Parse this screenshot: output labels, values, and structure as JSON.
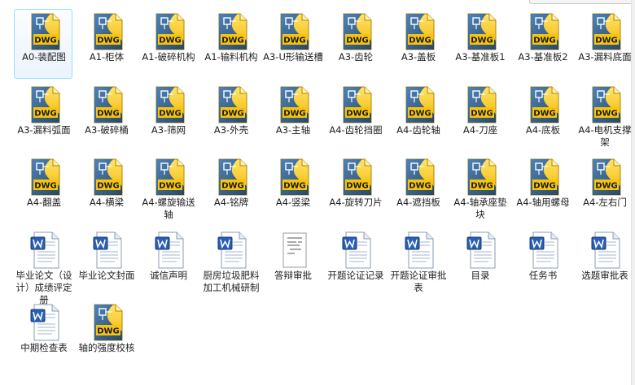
{
  "files": [
    {
      "name": "A0-装配图",
      "type": "dwg",
      "selected": true,
      "icon_label": "DWG"
    },
    {
      "name": "A1-柜体",
      "type": "dwg",
      "icon_label": "DWG"
    },
    {
      "name": "A1-破碎机构",
      "type": "dwg",
      "icon_label": "DWG"
    },
    {
      "name": "A1-输料机构",
      "type": "dwg",
      "icon_label": "DWG"
    },
    {
      "name": "A3-U形输送槽",
      "type": "dwg",
      "icon_label": "DWG"
    },
    {
      "name": "A3-齿轮",
      "type": "dwg",
      "icon_label": "DWG"
    },
    {
      "name": "A3-盖板",
      "type": "dwg",
      "icon_label": "DWG"
    },
    {
      "name": "A3-基准板1",
      "type": "dwg",
      "icon_label": "DWG"
    },
    {
      "name": "A3-基准板2",
      "type": "dwg",
      "icon_label": "DWG"
    },
    {
      "name": "A3-漏料底面",
      "type": "dwg",
      "icon_label": "DWG"
    },
    {
      "name": "A3-漏料弧面",
      "type": "dwg",
      "icon_label": "DWG"
    },
    {
      "name": "A3-破碎桶",
      "type": "dwg",
      "icon_label": "DWG"
    },
    {
      "name": "A3-筛网",
      "type": "dwg",
      "icon_label": "DWG"
    },
    {
      "name": "A3-外壳",
      "type": "dwg",
      "icon_label": "DWG"
    },
    {
      "name": "A3-主轴",
      "type": "dwg",
      "icon_label": "DWG"
    },
    {
      "name": "A4-齿轮挡圈",
      "type": "dwg",
      "icon_label": "DWG"
    },
    {
      "name": "A4-齿轮轴",
      "type": "dwg",
      "icon_label": "DWG"
    },
    {
      "name": "A4-刀座",
      "type": "dwg",
      "icon_label": "DWG"
    },
    {
      "name": "A4-底板",
      "type": "dwg",
      "icon_label": "DWG"
    },
    {
      "name": "A4-电机支撑架",
      "type": "dwg",
      "icon_label": "DWG"
    },
    {
      "name": "A4-翻盖",
      "type": "dwg",
      "icon_label": "DWG"
    },
    {
      "name": "A4-横梁",
      "type": "dwg",
      "icon_label": "DWG"
    },
    {
      "name": "A4-螺旋输送轴",
      "type": "dwg",
      "icon_label": "DWG"
    },
    {
      "name": "A4-铭牌",
      "type": "dwg",
      "icon_label": "DWG"
    },
    {
      "name": "A4-竖梁",
      "type": "dwg",
      "icon_label": "DWG"
    },
    {
      "name": "A4-旋转刀片",
      "type": "dwg",
      "icon_label": "DWG"
    },
    {
      "name": "A4-遮挡板",
      "type": "dwg",
      "icon_label": "DWG"
    },
    {
      "name": "A4-轴承座垫块",
      "type": "dwg",
      "icon_label": "DWG"
    },
    {
      "name": "A4-轴用螺母",
      "type": "dwg",
      "icon_label": "DWG"
    },
    {
      "name": "A4-左右门",
      "type": "dwg",
      "icon_label": "DWG"
    },
    {
      "name": "毕业论文（设计）成绩评定册",
      "type": "doc"
    },
    {
      "name": "毕业论文封面",
      "type": "doc"
    },
    {
      "name": "诚信声明",
      "type": "doc"
    },
    {
      "name": "厨房垃圾肥料加工机械研制",
      "type": "doc"
    },
    {
      "name": "答辩审批",
      "type": "scan"
    },
    {
      "name": "开题论证记录",
      "type": "doc"
    },
    {
      "name": "开题论证审批表",
      "type": "doc"
    },
    {
      "name": "目录",
      "type": "doc"
    },
    {
      "name": "任务书",
      "type": "doc"
    },
    {
      "name": "选题审批表",
      "type": "doc"
    },
    {
      "name": "中期检查表",
      "type": "doc"
    },
    {
      "name": "轴的强度校核",
      "type": "dwg",
      "icon_label": "DWG"
    }
  ],
  "colors": {
    "dwg_yellow": "#f6c40e",
    "dwg_blue": "#1b4f8c",
    "word_blue": "#2a5fb4",
    "selection_border": "#99defd",
    "label_text": "#1e1e1e"
  },
  "icons": {
    "dwg": "autocad-dwg-file-icon",
    "doc": "word-document-icon",
    "scan": "scanned-document-icon"
  }
}
